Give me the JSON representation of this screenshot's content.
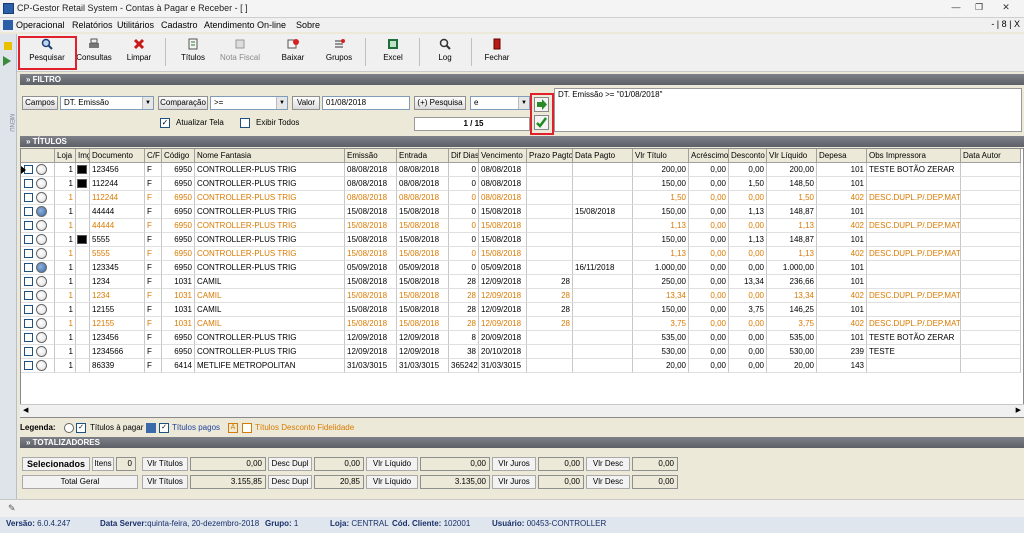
{
  "window": {
    "title": "CP-Gestor Retail System - Contas à Pagar e Receber - [ ]",
    "controls": [
      "—",
      "❐",
      "✕"
    ]
  },
  "menu": {
    "items": [
      "Operacional",
      "Relatórios",
      "Utilitários",
      "Cadastro",
      "Atendimento On-line",
      "Sobre"
    ],
    "mdi_controls": "- | 8 | X"
  },
  "toolbar": {
    "buttons": [
      {
        "label": "Pesquisar",
        "icon": "search-icon"
      },
      {
        "label": "Consultas",
        "icon": "printer-icon"
      },
      {
        "label": "Limpar",
        "icon": "clear-x-icon"
      },
      {
        "label": "Títulos",
        "icon": "titles-icon"
      },
      {
        "label": "Nota Fiscal",
        "icon": "invoice-icon"
      },
      {
        "label": "Baixar",
        "icon": "download-icon"
      },
      {
        "label": "Grupos",
        "icon": "groups-icon"
      },
      {
        "label": "Excel",
        "icon": "excel-icon"
      },
      {
        "label": "Log",
        "icon": "log-icon"
      },
      {
        "label": "Fechar",
        "icon": "close-door-icon"
      }
    ]
  },
  "filter": {
    "section_title": "» FILTRO",
    "campos_label": "Campos",
    "campos_value": "DT. Emissão",
    "comparacao_label": "Comparação",
    "comparacao_value": ">=",
    "valor_label": "Valor",
    "valor_value": "01/08/2018",
    "pesquisa_label": "(+) Pesquisa",
    "pesquisa_value": "e",
    "counter": "1 / 15",
    "atualizar_label": "Atualizar Tela",
    "atualizar_checked": "✓",
    "exibir_label": "Exibir Todos",
    "query_text": "DT. Emissão >= \"01/08/2018\""
  },
  "titulos": {
    "section_title": "» TÍTULOS",
    "columns": [
      "",
      "Loja",
      "Img",
      "Documento",
      "C/F",
      "Código",
      "Nome Fantasia",
      "Emissão",
      "Entrada",
      "Dif Dias",
      "Vencimento",
      "Prazo Pagto",
      "Data Pagto",
      "Vlr Título",
      "Acréscimo",
      "Desconto",
      "Vlr Líquido",
      "Depesa",
      "Obs Impressora",
      "Data Autor"
    ],
    "rows": [
      {
        "color": "#000000",
        "radio": "empty",
        "loja": "1",
        "img": "yes",
        "doc": "123456",
        "cf": "F",
        "cod": "6950",
        "nome": "CONTROLLER-PLUS TRIG",
        "emissao": "08/08/2018",
        "entrada": "08/08/2018",
        "dif": "0",
        "venc": "08/08/2018",
        "prazo": "",
        "dpag": "",
        "vlr": "200,00",
        "acr": "0,00",
        "desc": "0,00",
        "liq": "200,00",
        "desp": "101",
        "obs": "TESTE BOTÃO ZERAR"
      },
      {
        "color": "#000000",
        "radio": "empty",
        "loja": "1",
        "img": "yes",
        "doc": "112244",
        "cf": "F",
        "cod": "6950",
        "nome": "CONTROLLER-PLUS TRIG",
        "emissao": "08/08/2018",
        "entrada": "08/08/2018",
        "dif": "0",
        "venc": "08/08/2018",
        "prazo": "",
        "dpag": "",
        "vlr": "150,00",
        "acr": "0,00",
        "desc": "1,50",
        "liq": "148,50",
        "desp": "101",
        "obs": ""
      },
      {
        "color": "#d97a00",
        "radio": "empty",
        "loja": "1",
        "img": "",
        "doc": "112244",
        "cf": "F",
        "cod": "6950",
        "nome": "CONTROLLER-PLUS TRIG",
        "emissao": "08/08/2018",
        "entrada": "08/08/2018",
        "dif": "0",
        "venc": "08/08/2018",
        "prazo": "",
        "dpag": "",
        "vlr": "1,50",
        "acr": "0,00",
        "desc": "0,00",
        "liq": "1,50",
        "desp": "402",
        "obs": "DESC.DUPL.P/.DEP.MAT"
      },
      {
        "color": "#000000",
        "radio": "filled",
        "loja": "1",
        "img": "",
        "doc": "44444",
        "cf": "F",
        "cod": "6950",
        "nome": "CONTROLLER-PLUS TRIG",
        "emissao": "15/08/2018",
        "entrada": "15/08/2018",
        "dif": "0",
        "venc": "15/08/2018",
        "prazo": "",
        "dpag": "15/08/2018",
        "vlr": "150,00",
        "acr": "0,00",
        "desc": "1,13",
        "liq": "148,87",
        "desp": "101",
        "obs": ""
      },
      {
        "color": "#d97a00",
        "radio": "empty",
        "loja": "1",
        "img": "",
        "doc": "44444",
        "cf": "F",
        "cod": "6950",
        "nome": "CONTROLLER-PLUS TRIG",
        "emissao": "15/08/2018",
        "entrada": "15/08/2018",
        "dif": "0",
        "venc": "15/08/2018",
        "prazo": "",
        "dpag": "",
        "vlr": "1,13",
        "acr": "0,00",
        "desc": "0,00",
        "liq": "1,13",
        "desp": "402",
        "obs": "DESC.DUPL.P/.DEP.MAT"
      },
      {
        "color": "#000000",
        "radio": "empty",
        "loja": "1",
        "img": "yes",
        "doc": "5555",
        "cf": "F",
        "cod": "6950",
        "nome": "CONTROLLER-PLUS TRIG",
        "emissao": "15/08/2018",
        "entrada": "15/08/2018",
        "dif": "0",
        "venc": "15/08/2018",
        "prazo": "",
        "dpag": "",
        "vlr": "150,00",
        "acr": "0,00",
        "desc": "1,13",
        "liq": "148,87",
        "desp": "101",
        "obs": ""
      },
      {
        "color": "#d97a00",
        "radio": "empty",
        "loja": "1",
        "img": "",
        "doc": "5555",
        "cf": "F",
        "cod": "6950",
        "nome": "CONTROLLER-PLUS TRIG",
        "emissao": "15/08/2018",
        "entrada": "15/08/2018",
        "dif": "0",
        "venc": "15/08/2018",
        "prazo": "",
        "dpag": "",
        "vlr": "1,13",
        "acr": "0,00",
        "desc": "0,00",
        "liq": "1,13",
        "desp": "402",
        "obs": "DESC.DUPL.P/.DEP.MAT"
      },
      {
        "color": "#000000",
        "radio": "filled",
        "loja": "1",
        "img": "",
        "doc": "123345",
        "cf": "F",
        "cod": "6950",
        "nome": "CONTROLLER-PLUS TRIG",
        "emissao": "05/09/2018",
        "entrada": "05/09/2018",
        "dif": "0",
        "venc": "05/09/2018",
        "prazo": "",
        "dpag": "16/11/2018",
        "vlr": "1.000,00",
        "acr": "0,00",
        "desc": "0,00",
        "liq": "1.000,00",
        "desp": "101",
        "obs": ""
      },
      {
        "color": "#000000",
        "radio": "empty",
        "loja": "1",
        "img": "",
        "doc": "1234",
        "cf": "F",
        "cod": "1031",
        "nome": "CAMIL",
        "emissao": "15/08/2018",
        "entrada": "15/08/2018",
        "dif": "28",
        "venc": "12/09/2018",
        "prazo": "28",
        "dpag": "",
        "vlr": "250,00",
        "acr": "0,00",
        "desc": "13,34",
        "liq": "236,66",
        "desp": "101",
        "obs": ""
      },
      {
        "color": "#d97a00",
        "radio": "empty",
        "loja": "1",
        "img": "",
        "doc": "1234",
        "cf": "F",
        "cod": "1031",
        "nome": "CAMIL",
        "emissao": "15/08/2018",
        "entrada": "15/08/2018",
        "dif": "28",
        "venc": "12/09/2018",
        "prazo": "28",
        "dpag": "",
        "vlr": "13,34",
        "acr": "0,00",
        "desc": "0,00",
        "liq": "13,34",
        "desp": "402",
        "obs": "DESC.DUPL.P/.DEP.MAT"
      },
      {
        "color": "#000000",
        "radio": "empty",
        "loja": "1",
        "img": "",
        "doc": "12155",
        "cf": "F",
        "cod": "1031",
        "nome": "CAMIL",
        "emissao": "15/08/2018",
        "entrada": "15/08/2018",
        "dif": "28",
        "venc": "12/09/2018",
        "prazo": "28",
        "dpag": "",
        "vlr": "150,00",
        "acr": "0,00",
        "desc": "3,75",
        "liq": "146,25",
        "desp": "101",
        "obs": ""
      },
      {
        "color": "#d97a00",
        "radio": "empty",
        "loja": "1",
        "img": "",
        "doc": "12155",
        "cf": "F",
        "cod": "1031",
        "nome": "CAMIL",
        "emissao": "15/08/2018",
        "entrada": "15/08/2018",
        "dif": "28",
        "venc": "12/09/2018",
        "prazo": "28",
        "dpag": "",
        "vlr": "3,75",
        "acr": "0,00",
        "desc": "0,00",
        "liq": "3,75",
        "desp": "402",
        "obs": "DESC.DUPL.P/.DEP.MAT"
      },
      {
        "color": "#000000",
        "radio": "empty",
        "loja": "1",
        "img": "",
        "doc": "123456",
        "cf": "F",
        "cod": "6950",
        "nome": "CONTROLLER-PLUS TRIG",
        "emissao": "12/09/2018",
        "entrada": "12/09/2018",
        "dif": "8",
        "venc": "20/09/2018",
        "prazo": "",
        "dpag": "",
        "vlr": "535,00",
        "acr": "0,00",
        "desc": "0,00",
        "liq": "535,00",
        "desp": "101",
        "obs": "TESTE BOTÃO ZERAR"
      },
      {
        "color": "#000000",
        "radio": "empty",
        "loja": "1",
        "img": "",
        "doc": "1234566",
        "cf": "F",
        "cod": "6950",
        "nome": "CONTROLLER-PLUS TRIG",
        "emissao": "12/09/2018",
        "entrada": "12/09/2018",
        "dif": "38",
        "venc": "20/10/2018",
        "prazo": "",
        "dpag": "",
        "vlr": "530,00",
        "acr": "0,00",
        "desc": "0,00",
        "liq": "530,00",
        "desp": "239",
        "obs": "TESTE"
      },
      {
        "color": "#000000",
        "radio": "empty",
        "loja": "1",
        "img": "",
        "doc": "86339",
        "cf": "F",
        "cod": "6414",
        "nome": "METLIFE METROPOLITAN",
        "emissao": "31/03/3015",
        "entrada": "31/03/3015",
        "dif": "365242",
        "venc": "31/03/3015",
        "prazo": "",
        "dpag": "",
        "vlr": "20,00",
        "acr": "0,00",
        "desc": "0,00",
        "liq": "20,00",
        "desp": "143",
        "obs": ""
      }
    ]
  },
  "legend": {
    "label": "Legenda:",
    "a_pagar": "Títulos à pagar",
    "pagos": "Títulos pagos",
    "desconto": "Títulos Desconto Fidelidade",
    "desconto_marker": "A"
  },
  "totalizadores": {
    "section_title": "» TOTALIZADORES",
    "selecionados_label": "Selecionados",
    "itens_label": "Itens",
    "itens_value": "0",
    "total_geral_label": "Total Geral",
    "vlr_titulos_label": "Vlr Títulos",
    "desc_dupl_label": "Desc Dupl",
    "vlr_liquido_label": "Vlr Líquido",
    "vlr_juros_label": "Vlr Juros",
    "vlr_desc_label": "Vlr Desc",
    "sel": {
      "vlr_titulos": "0,00",
      "desc_dupl": "0,00",
      "vlr_liquido": "0,00",
      "vlr_juros": "0,00",
      "vlr_desc": "0,00"
    },
    "geral": {
      "vlr_titulos": "3.155,85",
      "desc_dupl": "20,85",
      "vlr_liquido": "3.135,00",
      "vlr_juros": "0,00",
      "vlr_desc": "0,00"
    }
  },
  "statusbar": {
    "versao_label": "Versão:",
    "versao": "6.0.4.247",
    "data_label": "Data Server:",
    "data": "quinta-feira, 20-dezembro-2018",
    "grupo_label": "Grupo:",
    "grupo": "1",
    "loja_label": "Loja:",
    "loja": "CENTRAL",
    "cliente_label": "Cód. Cliente:",
    "cliente": "102001",
    "usuario_label": "Usuário:",
    "usuario": "00453-CONTROLLER"
  },
  "sidebar_label": "MENU",
  "colors": {
    "accent_red": "#e0202a",
    "orange_row": "#d97a00",
    "section_bar": "#5c5f66"
  }
}
